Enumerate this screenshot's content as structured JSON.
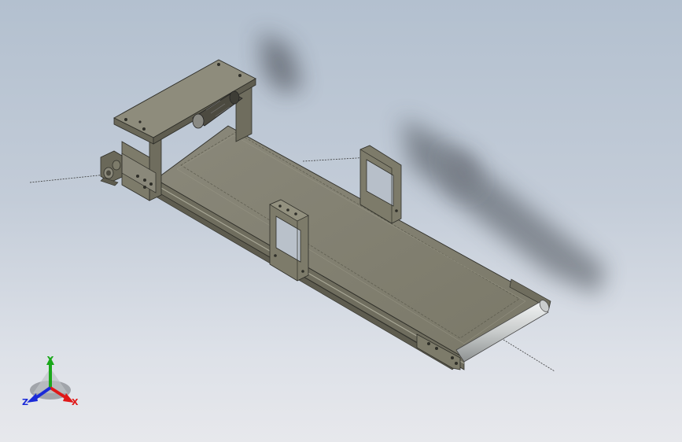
{
  "viewport": {
    "background_top": "#b3c0cf",
    "background_bottom": "#e7e8ec"
  },
  "model": {
    "body_color": "#7d7b6a",
    "dark_color": "#5e5c4f",
    "light_color": "#a8a796",
    "roller_color": "#d9dcdc"
  },
  "triad": {
    "x_label": "X",
    "y_label": "Y",
    "z_label": "Z",
    "x_color": "#e01818",
    "y_color": "#1aa81a",
    "z_color": "#1a2ad8"
  }
}
